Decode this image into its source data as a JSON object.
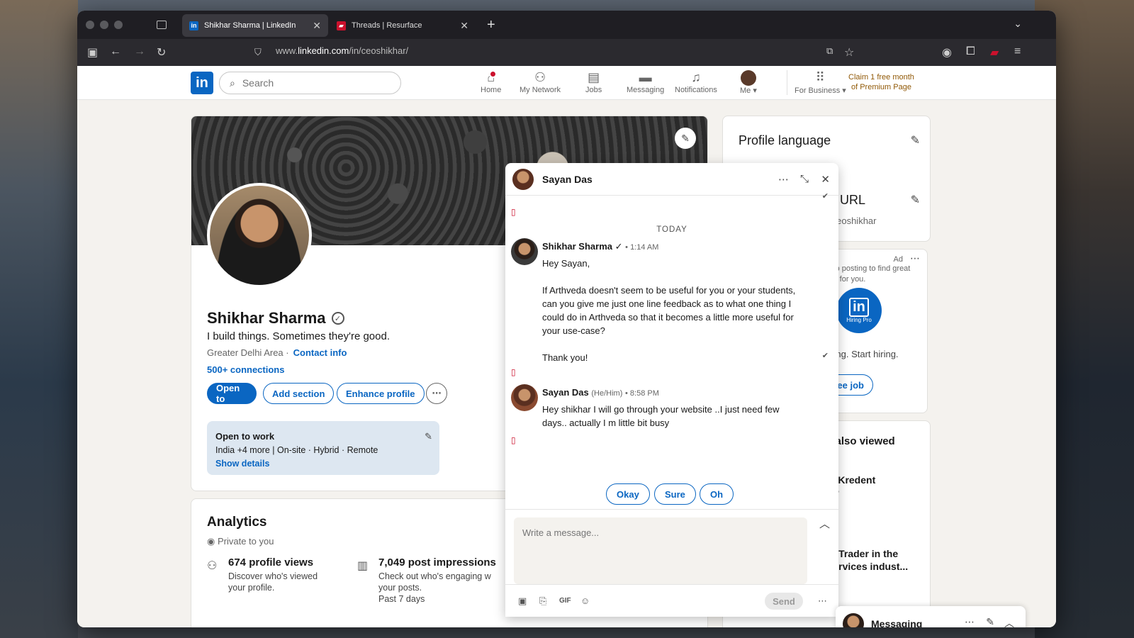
{
  "browser": {
    "tabs": [
      {
        "title": "Shikhar Sharma | LinkedIn",
        "favicon": "in",
        "color": "#0a66c2"
      },
      {
        "title": "Threads | Resurface",
        "favicon": "",
        "color": "#cb112d"
      }
    ],
    "url_prefix": "www.",
    "url_domain": "linkedin.com",
    "url_path": "/in/ceoshikhar/"
  },
  "header": {
    "search_placeholder": "Search",
    "nav": [
      {
        "label": "Home",
        "icon": "home-icon"
      },
      {
        "label": "My Network",
        "icon": "network-icon"
      },
      {
        "label": "Jobs",
        "icon": "briefcase-icon"
      },
      {
        "label": "Messaging",
        "icon": "chat-icon"
      },
      {
        "label": "Notifications",
        "icon": "bell-icon"
      },
      {
        "label": "Me",
        "icon": "avatar-icon"
      },
      {
        "label": "For Business",
        "icon": "grid-icon"
      }
    ],
    "premium_line1": "Claim 1 free month",
    "premium_line2": "of Premium Page"
  },
  "profile": {
    "name": "Shikhar Sharma",
    "headline": "I build things. Sometimes they're good.",
    "location": "Greater Delhi Area",
    "contact": "Contact info",
    "connections": "500+ connections",
    "buttons": {
      "open_to": "Open to",
      "add_section": "Add section",
      "enhance": "Enhance profile"
    },
    "open_to_work": {
      "title": "Open to work",
      "details": "India +4 more | On-site · Hybrid · Remote",
      "link": "Show details"
    }
  },
  "analytics": {
    "title": "Analytics",
    "privacy": "Private to you",
    "items": [
      {
        "value": "674 profile views",
        "line1": "Discover who's viewed",
        "line2": "your profile."
      },
      {
        "value": "7,049 post impressions",
        "line1": "Check out who's engaging w",
        "line2": "your posts.",
        "line3": "Past 7 days"
      }
    ]
  },
  "sidebar": {
    "profile_language": "Profile language",
    "public_url_label": "& URL",
    "public_url": "/ceoshikhar",
    "ad_label": "Ad",
    "ad_text1": "job posting to find great",
    "ad_text2": "es for you.",
    "ad_badge": "Hiring Pro",
    "ad_cta_text": "iting. Start hiring.",
    "ad_button": "free job",
    "also_viewed": "s also viewed",
    "viewed1_line1": "at Kredent",
    "viewed1_line2": "LP",
    "viewed2_line1": "nt Trader in the",
    "viewed2_line2": "Services indust..."
  },
  "chat": {
    "contact": "Sayan Das",
    "day_label": "TODAY",
    "messages": [
      {
        "sender": "Shikhar Sharma",
        "time": "• 1:14 AM",
        "lines": [
          "Hey Sayan,",
          "If Arthveda doesn't seem to be useful for you or your students, can you give me just one line feedback as to what one thing I could do in Arthveda so that it becomes a little more useful for your use-case?",
          "Thank you!"
        ]
      },
      {
        "sender": "Sayan Das",
        "pronoun": "(He/Him)",
        "time": "• 8:58 PM",
        "lines": [
          "Hey shikhar I will go through your website ..I just need few days.. actually I m little bit busy"
        ]
      }
    ],
    "quick_replies": [
      "Okay",
      "Sure",
      "Oh"
    ],
    "compose_placeholder": "Write a message...",
    "send_label": "Send"
  },
  "messaging_bar": {
    "label": "Messaging"
  }
}
